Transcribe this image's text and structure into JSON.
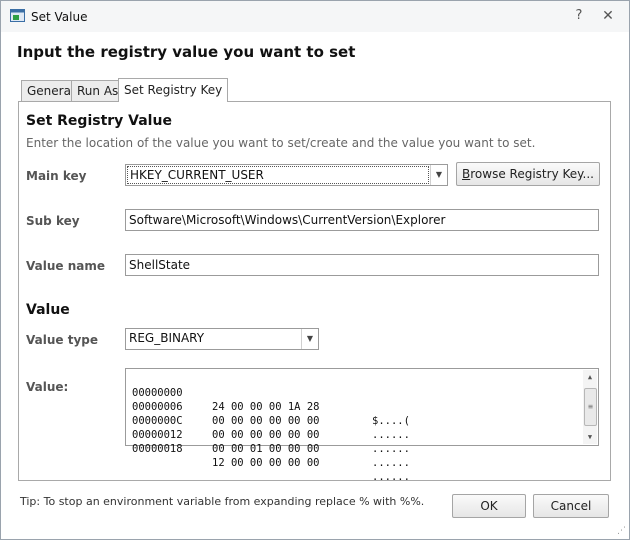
{
  "window": {
    "title": "Set Value",
    "help_glyph": "?",
    "close_glyph": "✕"
  },
  "dialog": {
    "heading": "Input the registry value you want to set"
  },
  "tabs": [
    {
      "label": "General",
      "active": false
    },
    {
      "label": "Run As",
      "active": false
    },
    {
      "label": "Set Registry Key",
      "active": true
    }
  ],
  "registry": {
    "section_title": "Set Registry Value",
    "description": "Enter the location of the value you want to set/create and the value you want to set.",
    "main_key": {
      "label": "Main key",
      "value": "HKEY_CURRENT_USER"
    },
    "browse_button": {
      "accel": "B",
      "rest": "rowse Registry Key..."
    },
    "sub_key": {
      "label": "Sub key",
      "value": "Software\\Microsoft\\Windows\\CurrentVersion\\Explorer"
    },
    "value_name": {
      "label": "Value name",
      "value": "ShellState"
    }
  },
  "value_section": {
    "title": "Value",
    "value_type": {
      "label": "Value type",
      "value": "REG_BINARY"
    },
    "value_label": "Value:",
    "hex_rows": [
      {
        "offset": "00000000",
        "bytes": "24 00 00 00 1A 28",
        "ascii": "$....("
      },
      {
        "offset": "00000006",
        "bytes": "00 00 00 00 00 00",
        "ascii": "......"
      },
      {
        "offset": "0000000C",
        "bytes": "00 00 00 00 00 00",
        "ascii": "......"
      },
      {
        "offset": "00000012",
        "bytes": "00 00 01 00 00 00",
        "ascii": "......"
      },
      {
        "offset": "00000018",
        "bytes": "12 00 00 00 00 00",
        "ascii": "......"
      }
    ]
  },
  "footer": {
    "tip": "Tip: To stop an environment variable from expanding replace % with %%.",
    "ok_label": "OK",
    "cancel_label": "Cancel"
  },
  "colors": {
    "border": "#a9a9a9",
    "window_bg": "#f0f0f0",
    "panel_bg": "#ffffff"
  }
}
